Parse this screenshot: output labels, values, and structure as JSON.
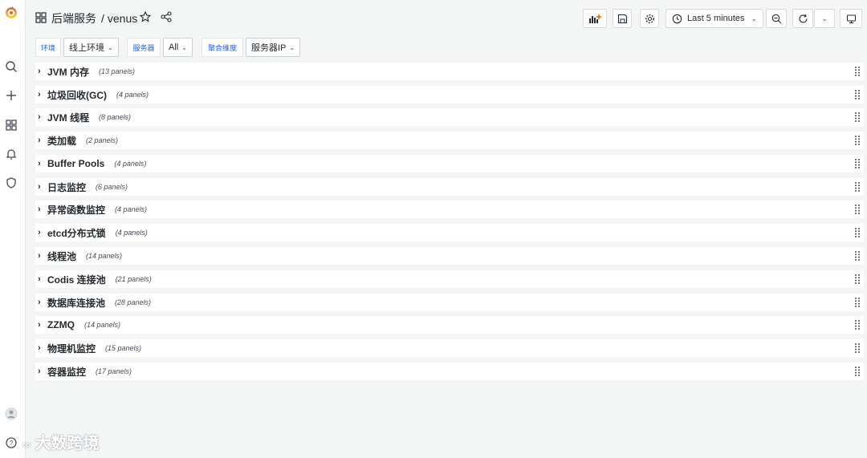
{
  "header": {
    "folder": "后端服务",
    "separator": "/",
    "dashboard": "venus"
  },
  "toolbar": {
    "time_range": "Last 5 minutes"
  },
  "variables": [
    {
      "label": "环境",
      "value": "线上环境"
    },
    {
      "label": "服务器",
      "value": "All"
    },
    {
      "label": "聚合维度",
      "value": "服务器IP"
    }
  ],
  "rows": [
    {
      "title": "JVM 内存",
      "count": "(13 panels)"
    },
    {
      "title": "垃圾回收(GC)",
      "count": "(4 panels)"
    },
    {
      "title": "JVM 线程",
      "count": "(8 panels)"
    },
    {
      "title": "类加载",
      "count": "(2 panels)"
    },
    {
      "title": "Buffer Pools",
      "count": "(4 panels)"
    },
    {
      "title": "日志监控",
      "count": "(6 panels)"
    },
    {
      "title": "异常函数监控",
      "count": "(4 panels)"
    },
    {
      "title": "etcd分布式锁",
      "count": "(4 panels)"
    },
    {
      "title": "线程池",
      "count": "(14 panels)"
    },
    {
      "title": "Codis 连接池",
      "count": "(21 panels)"
    },
    {
      "title": "数据库连接池",
      "count": "(28 panels)"
    },
    {
      "title": "ZZMQ",
      "count": "(14 panels)"
    },
    {
      "title": "物理机监控",
      "count": "(15 panels)"
    },
    {
      "title": "容器监控",
      "count": "(17 panels)"
    }
  ],
  "watermark": "大数跨境",
  "colors": {
    "logo_orange": "#f46800",
    "logo_yellow": "#fbca0a",
    "variable_label": "#1f62e0",
    "background": "#f4f5f5"
  }
}
